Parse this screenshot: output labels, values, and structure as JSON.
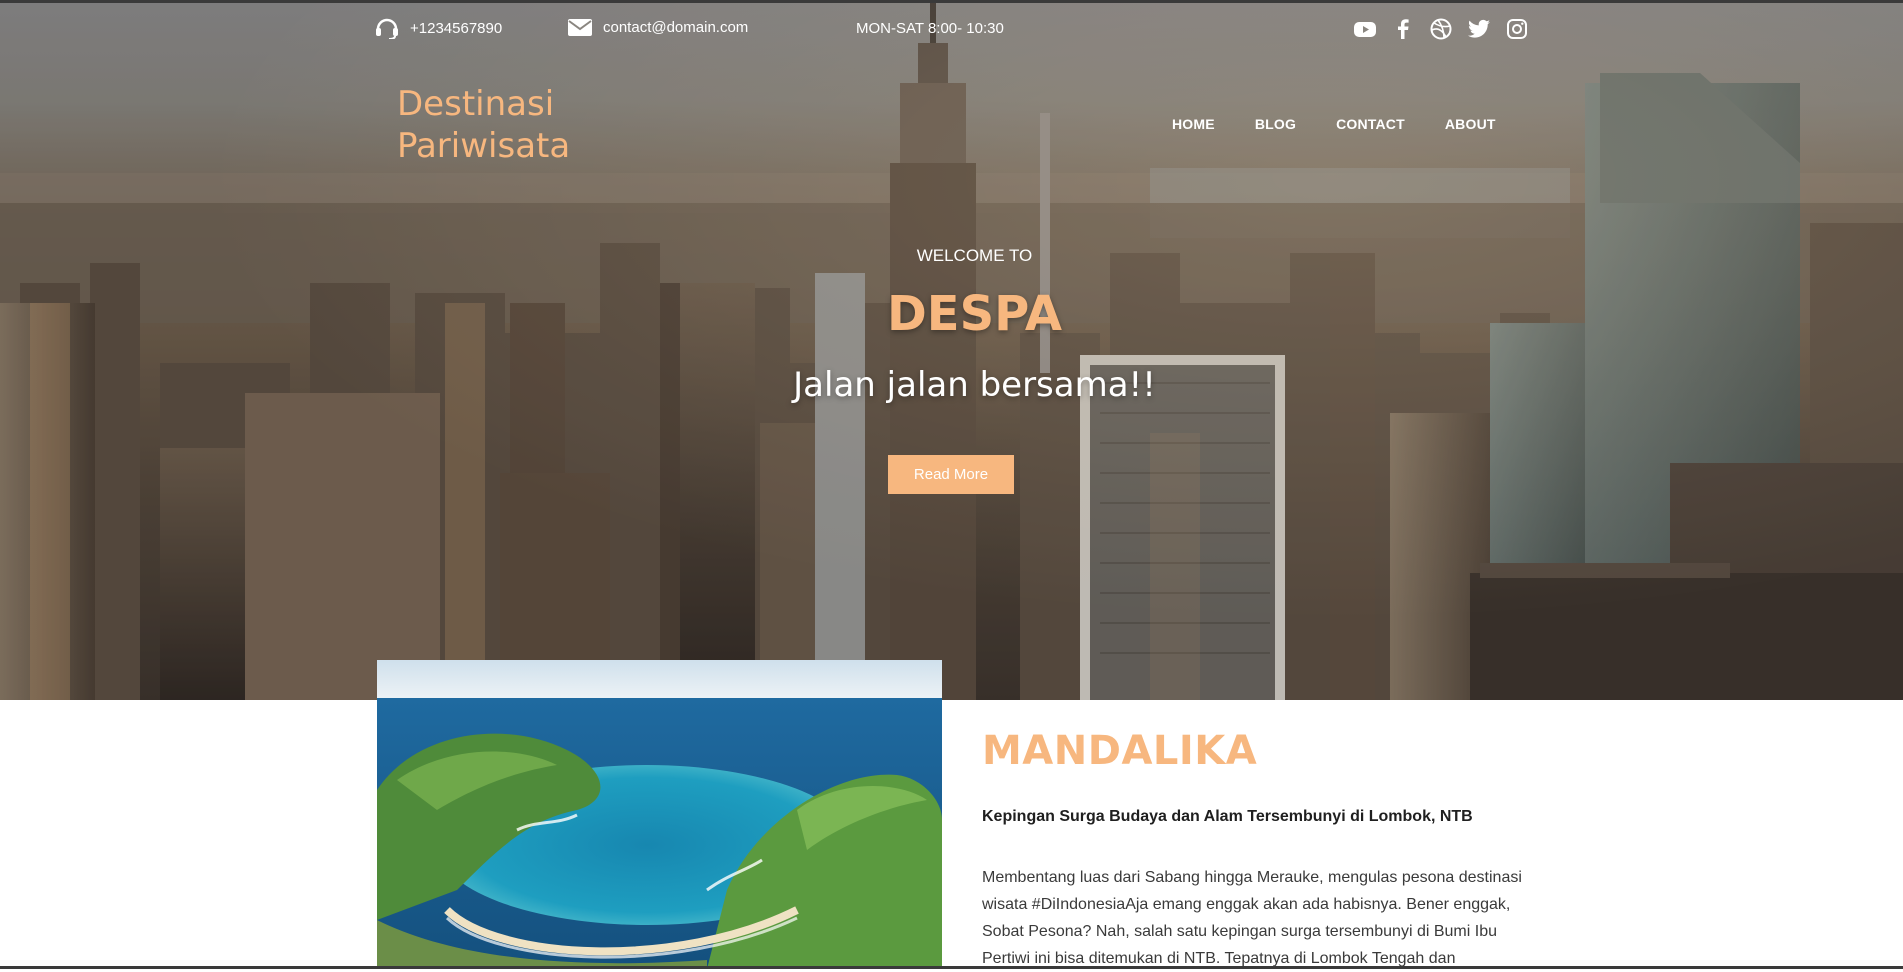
{
  "topbar": {
    "phone": "+1234567890",
    "email": "contact@domain.com",
    "hours": "MON-SAT 8:00- 10:30",
    "social": [
      "youtube-icon",
      "facebook-icon",
      "dribbble-icon",
      "twitter-icon",
      "instagram-icon"
    ]
  },
  "header": {
    "logo_line1": "Destinasi",
    "logo_line2": "Pariwisata",
    "nav": [
      "HOME",
      "BLOG",
      "CONTACT",
      "ABOUT"
    ]
  },
  "hero": {
    "welcome": "WELCOME TO",
    "brand": "DESPA",
    "tagline": "Jalan jalan bersama!!",
    "button_label": "Read More"
  },
  "feature": {
    "title": "MANDALIKA",
    "subtitle": "Kepingan Surga Budaya dan Alam Tersembunyi di Lombok, NTB",
    "body": "Membentang luas dari Sabang hingga Merauke, mengulas pesona destinasi wisata #DiIndonesiaAja emang enggak akan ada habisnya. Bener enggak, Sobat Pesona? Nah, salah satu kepingan surga tersembunyi di Bumi Ibu Pertiwi ini bisa ditemukan di NTB. Tepatnya di Lombok Tengah dan"
  },
  "colors": {
    "accent": "#f7b77f",
    "text_dark": "#1f1f1f",
    "text_body": "#3a3a3a"
  }
}
